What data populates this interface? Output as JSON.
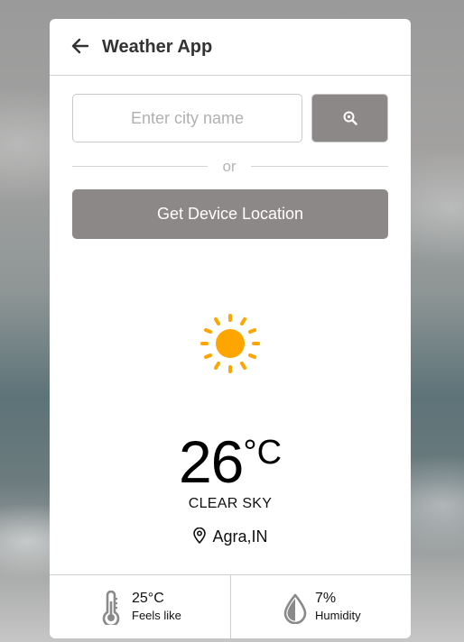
{
  "header": {
    "title": "Weather App",
    "back_icon": "arrow-left-icon"
  },
  "search": {
    "placeholder": "Enter city name",
    "value": "",
    "button_icon": "search-icon"
  },
  "divider": {
    "text": "or"
  },
  "location_button": {
    "label": "Get Device Location"
  },
  "weather": {
    "icon": "sun-icon",
    "temperature": "26",
    "unit": "°C",
    "condition": "CLEAR SKY",
    "location": "Agra,IN",
    "location_icon": "map-pin-icon"
  },
  "details": {
    "feels_like": {
      "value": "25°C",
      "label": "Feels like",
      "icon": "thermometer-icon"
    },
    "humidity": {
      "value": "7%",
      "label": "Humidity",
      "icon": "water-drop-icon"
    }
  },
  "colors": {
    "button": "#8d8888",
    "sun": "#ffa500",
    "card": "#ffffff",
    "divider": "#cfcfcf"
  }
}
